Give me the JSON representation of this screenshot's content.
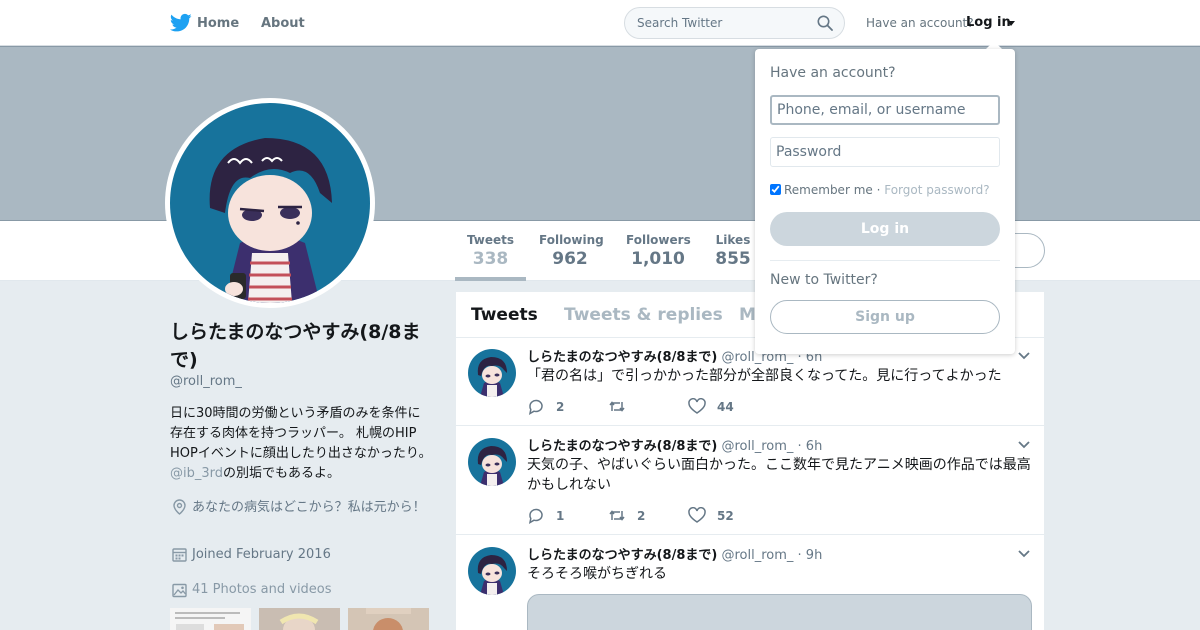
{
  "colors": {
    "brand": "#1da1f2",
    "muted": "#657786",
    "banner": "#aab8c2",
    "bg": "#e6ecf0"
  },
  "nav": {
    "logo_icon": "twitter-bird-icon",
    "home_label": "Home",
    "about_label": "About",
    "search_placeholder": "Search Twitter",
    "search_icon": "search-icon",
    "have_account": "Have an account?",
    "login_label": "Log in"
  },
  "profile": {
    "name": "しらたまのなつやすみ(8/8まで)",
    "handle": "@roll_rom_",
    "bio_pre": "日に30時間の労働という矛盾のみを条件に存在する肉体を持つラッパー。 札幌のHIP HOPイベントに顔出したり出さなかったり。 ",
    "bio_mention": "@ib_3rd",
    "bio_post": "の別垢でもあるよ。",
    "location": "あなたの病気はどこから？私は元から！",
    "joined": "Joined February 2016",
    "photos": "41 Photos and videos"
  },
  "stats": [
    {
      "label": "Tweets",
      "value": "338"
    },
    {
      "label": "Following",
      "value": "962"
    },
    {
      "label": "Followers",
      "value": "1,010"
    },
    {
      "label": "Likes",
      "value": "855"
    }
  ],
  "timeline": {
    "tabs": [
      "Tweets",
      "Tweets & replies",
      "M"
    ],
    "tweets": [
      {
        "name": "しらたまのなつやすみ(8/8まで)",
        "handle": "@roll_rom_",
        "time": "· 6h",
        "text": "「君の名は」で引っかかった部分が全部良くなってた。見に行ってよかった",
        "replies": "2",
        "retweets": "",
        "likes": "44"
      },
      {
        "name": "しらたまのなつやすみ(8/8まで)",
        "handle": "@roll_rom_",
        "time": "· 6h",
        "text": "天気の子、やばいぐらい面白かった。ここ数年で見たアニメ映画の作品では最高かもしれない",
        "replies": "1",
        "retweets": "2",
        "likes": "52"
      },
      {
        "name": "しらたまのなつやすみ(8/8まで)",
        "handle": "@roll_rom_",
        "time": "· 9h",
        "text": "そろそろ喉がちぎれる",
        "replies": "",
        "retweets": "",
        "likes": ""
      }
    ]
  },
  "login_dropdown": {
    "title": "Have an account?",
    "username_placeholder": "Phone, email, or username",
    "password_placeholder": "Password",
    "remember": "Remember me",
    "separator": " · ",
    "forgot": "Forgot password?",
    "login_button": "Log in",
    "new_to": "New to Twitter?",
    "signup_button": "Sign up"
  }
}
